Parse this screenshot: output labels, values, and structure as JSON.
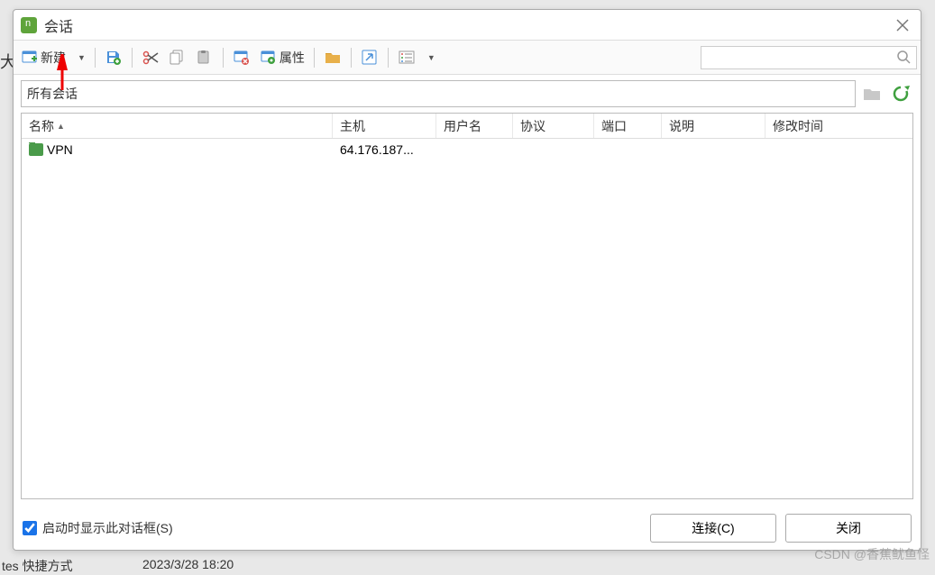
{
  "window": {
    "title": "会话"
  },
  "toolbar": {
    "new_label": "新建",
    "props_label": "属性"
  },
  "breadcrumb": {
    "path": "所有会话"
  },
  "columns": {
    "name": "名称",
    "host": "主机",
    "user": "用户名",
    "protocol": "协议",
    "port": "端口",
    "desc": "说明",
    "mtime": "修改时间"
  },
  "rows": [
    {
      "name": "VPN",
      "host": "64.176.187...",
      "user": "",
      "protocol": "",
      "port": "",
      "desc": "",
      "mtime": ""
    }
  ],
  "footer": {
    "show_on_start": "启动时显示此对话框(S)",
    "connect": "连接(C)",
    "close": "关闭"
  },
  "behind": {
    "text1": "tes  快捷方式",
    "date": "2023/3/28  18:20",
    "left_char": "大"
  },
  "watermark": "CSDN @香蕉鱿鱼怪"
}
